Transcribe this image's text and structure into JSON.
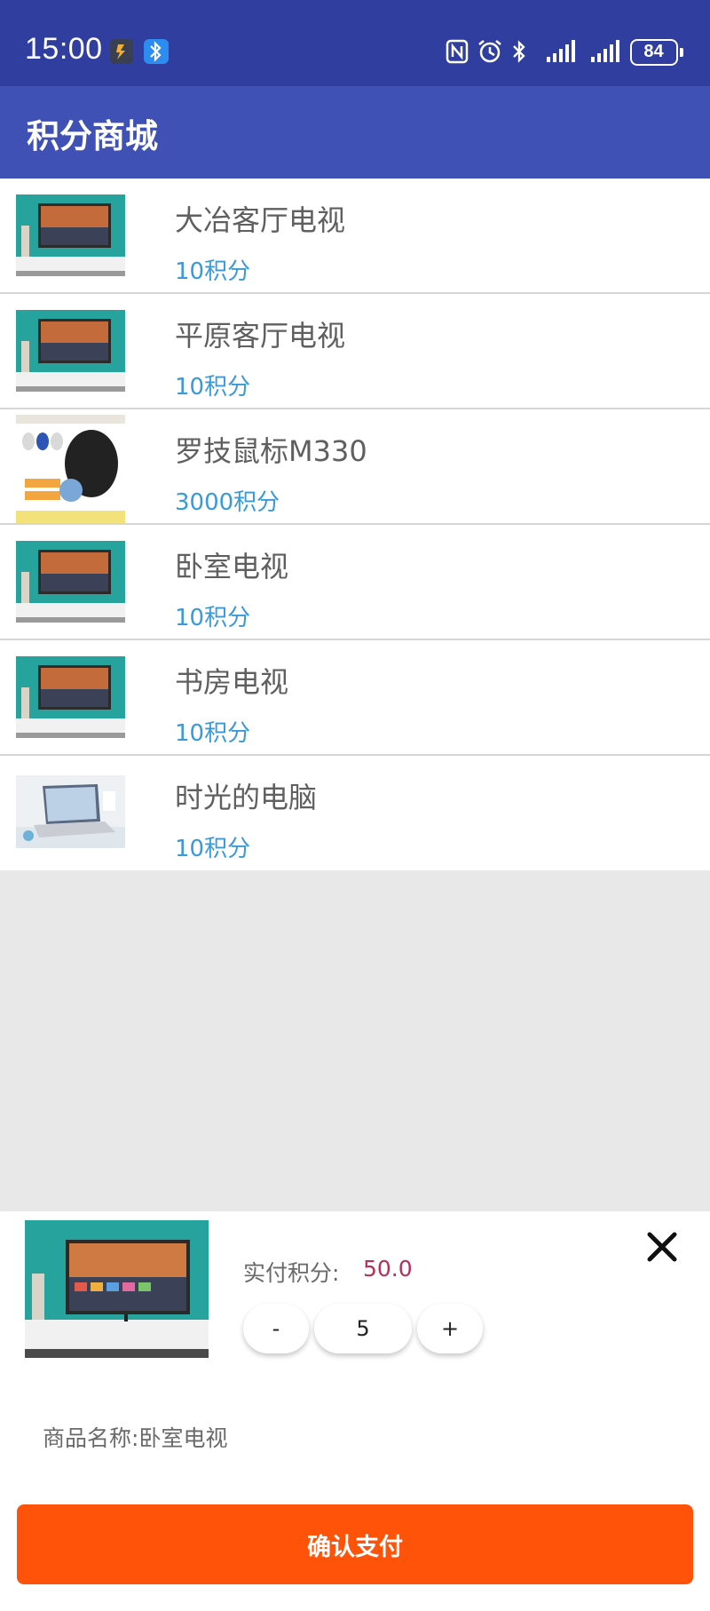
{
  "status_bar": {
    "time": "15:00",
    "battery": "84",
    "icons": [
      "activity-app-icon",
      "bluetooth-app-icon",
      "nfc-icon",
      "alarm-icon",
      "bluetooth-icon",
      "signal-icon",
      "signal-icon",
      "battery-icon"
    ]
  },
  "app_bar": {
    "title": "积分商城"
  },
  "products": [
    {
      "name": "大冶客厅电视",
      "price": "10积分",
      "thumb": "tv"
    },
    {
      "name": "平原客厅电视",
      "price": "10积分",
      "thumb": "tv"
    },
    {
      "name": "罗技鼠标M330",
      "price": "3000积分",
      "thumb": "mouse"
    },
    {
      "name": "卧室电视",
      "price": "10积分",
      "thumb": "tv"
    },
    {
      "name": "书房电视",
      "price": "10积分",
      "thumb": "tv"
    },
    {
      "name": "时光的电脑",
      "price": "10积分",
      "thumb": "laptop"
    }
  ],
  "sheet": {
    "pay_label": "实付积分:",
    "pay_value": "50.0",
    "minus_label": "-",
    "quantity": "5",
    "plus_label": "+",
    "name_label": "商品名称:",
    "name_value": "卧室电视",
    "confirm_label": "确认支付"
  },
  "colors": {
    "status_bar": "#303f9f",
    "app_bar": "#3f51b5",
    "price": "#3a9ad9",
    "pay_value": "#b5305a",
    "confirm": "#ff5309"
  }
}
